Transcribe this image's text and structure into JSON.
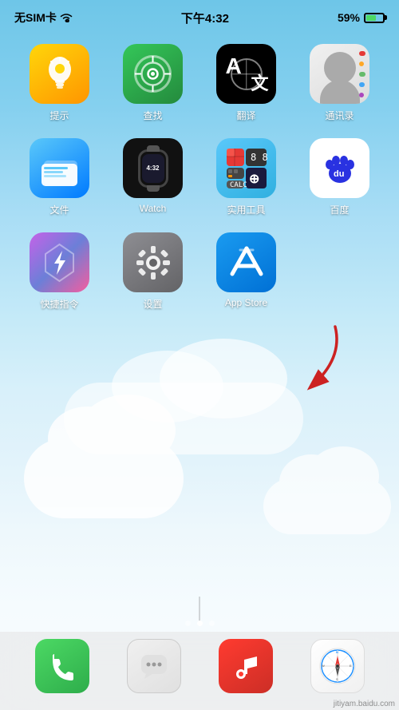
{
  "statusBar": {
    "carrier": "无SIM卡",
    "time": "下午4:32",
    "battery": "59%"
  },
  "apps": [
    {
      "id": "tishi",
      "label": "提示",
      "icon": "bulb"
    },
    {
      "id": "chazhao",
      "label": "查找",
      "icon": "findmy"
    },
    {
      "id": "fanyi",
      "label": "翻译",
      "icon": "translate"
    },
    {
      "id": "tongxunlu",
      "label": "通讯录",
      "icon": "contacts"
    },
    {
      "id": "wenjian",
      "label": "文件",
      "icon": "files"
    },
    {
      "id": "watch",
      "label": "Watch",
      "icon": "watch"
    },
    {
      "id": "shiyong",
      "label": "实用工具",
      "icon": "utility"
    },
    {
      "id": "baidu",
      "label": "百度",
      "icon": "baidu"
    },
    {
      "id": "kuaijie",
      "label": "快捷指令",
      "icon": "shortcuts"
    },
    {
      "id": "shezhi",
      "label": "设置",
      "icon": "settings"
    },
    {
      "id": "appstore",
      "label": "App Store",
      "icon": "appstore"
    }
  ],
  "dock": [
    {
      "id": "phone",
      "label": "电话"
    },
    {
      "id": "messages",
      "label": "信息"
    },
    {
      "id": "music",
      "label": "音乐"
    },
    {
      "id": "safari",
      "label": "Safari"
    }
  ],
  "pageDots": [
    0,
    1,
    2
  ],
  "activeDot": 1,
  "watermark": "jitiyam.baidu.com"
}
